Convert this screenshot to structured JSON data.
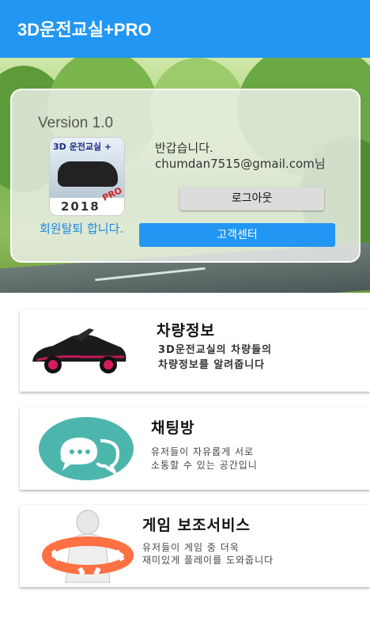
{
  "app_bar": {
    "title": "3D운전교실+PRO",
    "color": "#2196f3"
  },
  "account_card": {
    "version": "Version 1.0",
    "app_icon": {
      "label": "3D 운전교실 +",
      "year": "2018",
      "badge": "PRO"
    },
    "withdraw_link": "회원탈퇴 합니다.",
    "greeting": "반갑습니다.",
    "email": "chumdan7515@gmail.com님",
    "logout_button": "로그아웃",
    "customer_center_button": "고객센터"
  },
  "menu": [
    {
      "title": "차량정보",
      "desc1": "3D운전교실의 차량들의",
      "desc2": "차량정보를 알려줍니다",
      "icon": "sports-car-icon"
    },
    {
      "title": "채팅방",
      "desc1": "유저들이 자유롭게 서로",
      "desc2": "소통할 수 있는 공간입니",
      "icon": "chat-bubbles-icon"
    },
    {
      "title": "게임 보조서비스",
      "desc1": "유저들이 게임 중 더욱",
      "desc2": "재미있게 플레이를 도와줍니다",
      "icon": "lifebuoy-helper-icon"
    }
  ]
}
